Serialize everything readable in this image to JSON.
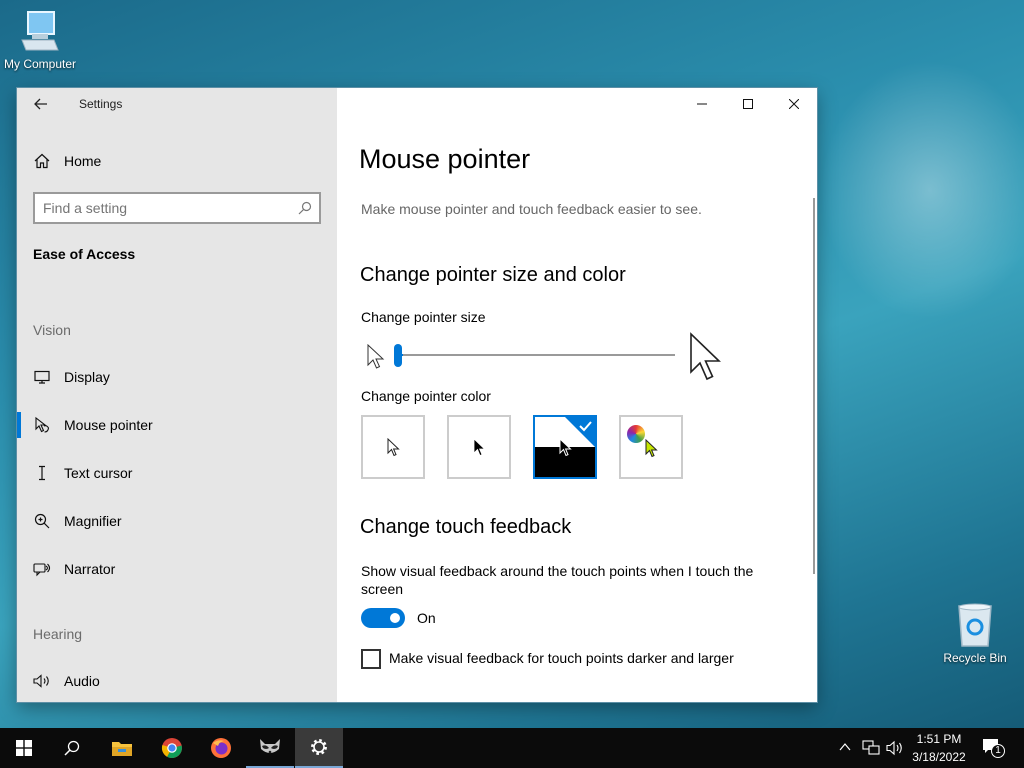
{
  "desktop": {
    "icons": [
      {
        "label": "My Computer",
        "icon": "computer-icon"
      },
      {
        "label": "Recycle Bin",
        "icon": "recycle-bin-icon"
      }
    ]
  },
  "window": {
    "app_title": "Settings",
    "controls": {
      "minimize": "minimize-icon",
      "maximize": "maximize-icon",
      "close": "close-icon"
    }
  },
  "sidebar": {
    "home_label": "Home",
    "search_placeholder": "Find a setting",
    "category": "Ease of Access",
    "sections": [
      {
        "label": "Vision",
        "items": [
          {
            "label": "Display",
            "icon": "display-icon"
          },
          {
            "label": "Mouse pointer",
            "icon": "mouse-pointer-icon",
            "selected": true
          },
          {
            "label": "Text cursor",
            "icon": "text-cursor-icon"
          },
          {
            "label": "Magnifier",
            "icon": "magnifier-icon"
          },
          {
            "label": "Narrator",
            "icon": "narrator-icon"
          }
        ]
      },
      {
        "label": "Hearing",
        "items": [
          {
            "label": "Audio",
            "icon": "audio-icon"
          }
        ]
      }
    ]
  },
  "main": {
    "page_title": "Mouse pointer",
    "description": "Make mouse pointer and touch feedback easier to see.",
    "pointer_section": {
      "heading": "Change pointer size and color",
      "size_label": "Change pointer size",
      "size_value": 1,
      "size_range": [
        1,
        15
      ],
      "color_label": "Change pointer color",
      "color_options": [
        "white",
        "black",
        "inverted",
        "custom"
      ],
      "selected_color": "inverted"
    },
    "touch_section": {
      "heading": "Change touch feedback",
      "show_feedback_label": "Show visual feedback around the touch points when I touch the screen",
      "toggle_state": "On",
      "darker_label": "Make visual feedback for touch points darker and larger",
      "darker_checked": false
    }
  },
  "taskbar": {
    "time": "1:51 PM",
    "date": "3/18/2022",
    "notification_count": "1",
    "pinned": [
      "start-icon",
      "search-icon",
      "file-explorer-icon",
      "chrome-icon",
      "firefox-icon",
      "raccoon-app-icon",
      "settings-icon"
    ]
  },
  "colors": {
    "accent": "#0078d7",
    "sidebar_bg": "#e6e6e6",
    "taskbar_bg": "#0b0b0b"
  }
}
